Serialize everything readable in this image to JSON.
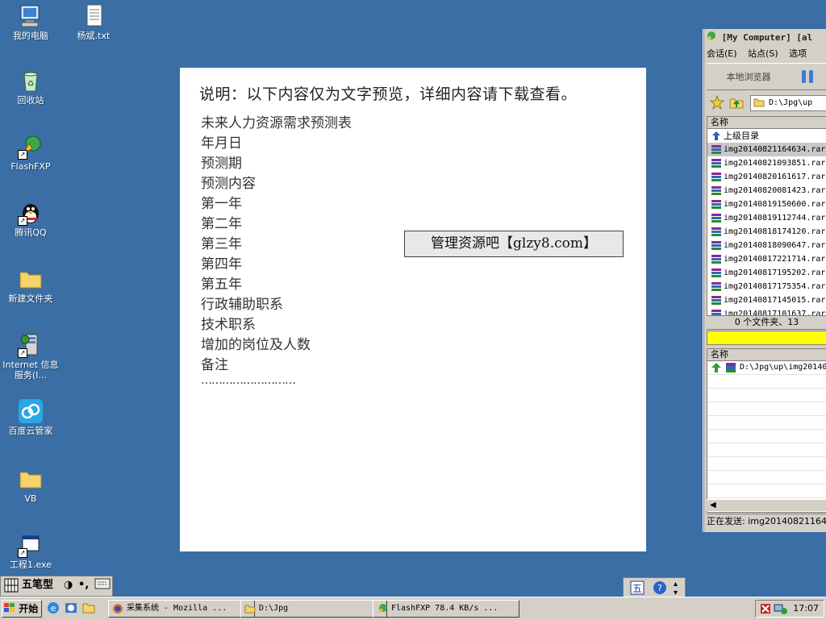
{
  "desktop": {
    "icons": [
      {
        "label": "我的电脑",
        "icon": "my-computer-icon"
      },
      {
        "label": "杨斌.txt",
        "icon": "text-file-icon"
      },
      {
        "label": "回收站",
        "icon": "recycle-bin-icon"
      },
      {
        "label": "FlashFXP",
        "icon": "flashfxp-icon"
      },
      {
        "label": "腾讯QQ",
        "icon": "qq-penguin-icon"
      },
      {
        "label": "新建文件夹",
        "icon": "folder-icon"
      },
      {
        "label": "Internet 信息服务(I...",
        "icon": "iis-icon"
      },
      {
        "label": "百度云管家",
        "icon": "baidu-cloud-icon"
      },
      {
        "label": "VB",
        "icon": "folder-icon"
      },
      {
        "label": "工程1.exe",
        "icon": "exe-icon"
      }
    ]
  },
  "preview": {
    "title": "说明：以下内容仅为文字预览，详细内容请下载查看。",
    "lines": [
      "未来人力资源需求预测表",
      "年月日",
      "预测期",
      "预测内容",
      "第一年",
      "第二年",
      "第三年",
      "第四年",
      "第五年",
      "行政辅助职系",
      "技术职系",
      "增加的岗位及人数",
      "备注"
    ],
    "dots": "………………………",
    "watermark": "管理资源吧【glzy8.com】"
  },
  "ftp": {
    "title": "[My Computer]  [al",
    "menu": [
      "会话(E)",
      "站点(S)",
      "选项"
    ],
    "local_browser": "本地浏览器",
    "path": "D:\\Jpg\\up",
    "column": "名称",
    "parent_dir": "上级目录",
    "files": [
      "img20140821164634.rar",
      "img20140821093851.rar",
      "img20140820161617.rar",
      "img20140820081423.rar",
      "img20140819150600.rar",
      "img20140819112744.rar",
      "img20140818174120.rar",
      "img20140818090647.rar",
      "img20140817221714.rar",
      "img20140817195202.rar",
      "img20140817175354.rar",
      "img20140817145015.rar",
      "img20140817101637.rar"
    ],
    "status": "0 个文件夹、13",
    "progress": 1.0,
    "queue_column": "名称",
    "queue_item": "D:\\Jpg\\up\\img20140",
    "sending": "正在发送: img20140821164"
  },
  "imebar": {
    "brand": "五笔型"
  },
  "taskbar": {
    "start": "开始",
    "tasks": [
      {
        "label": "采集系统 - Mozilla ...",
        "icon": "firefox-icon"
      },
      {
        "label": "D:\\Jpg",
        "icon": "folder-icon"
      },
      {
        "label": "FlashFXP 78.4 KB/s ...",
        "icon": "flashfxp-icon"
      }
    ],
    "clock": "17:07"
  },
  "colors": {
    "desktop": "#3a6ea5",
    "progress": "#ffff00"
  }
}
